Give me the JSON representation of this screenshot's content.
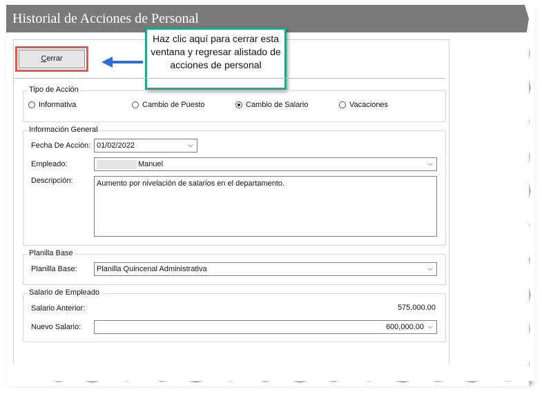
{
  "window": {
    "title": "Historial de Acciones de Personal"
  },
  "toolbar": {
    "close_label": "Cerrar",
    "close_mnemonic": "C",
    "close_rest": "errar"
  },
  "callout": {
    "text": "Haz clic aquí para cerrar esta ventana y regresar alistado de acciones de personal"
  },
  "tipo_accion": {
    "legend": "Tipo de Acción",
    "options": [
      {
        "label": "Informativa",
        "checked": false
      },
      {
        "label": "Cambio de Puesto",
        "checked": false
      },
      {
        "label": "Cambio de Salario",
        "checked": true
      },
      {
        "label": "Vacaciones",
        "checked": false
      }
    ]
  },
  "info_general": {
    "legend": "Información General",
    "fecha_label": "Fecha De Acción:",
    "fecha_value": "01/02/2022",
    "empleado_label": "Empleado:",
    "empleado_value": "Manuel",
    "descripcion_label": "Descripción:",
    "descripcion_value": "Aumento por nivelación de salarios en el  departamento."
  },
  "planilla": {
    "legend": "Planilla Base",
    "label": "Planilla Base:",
    "value": "Planilla Quincenal Administrativa"
  },
  "salario": {
    "legend": "Salario de Empleado",
    "anterior_label": "Salario Anterior:",
    "anterior_value": "575,000.00",
    "nuevo_label": "Nuevo Salario:",
    "nuevo_value": "600,000.00"
  },
  "colors": {
    "titlebar": "#7a7a7a",
    "highlight": "#e0574b",
    "callout_border": "#2aa38d",
    "arrow": "#2f6fd0"
  }
}
